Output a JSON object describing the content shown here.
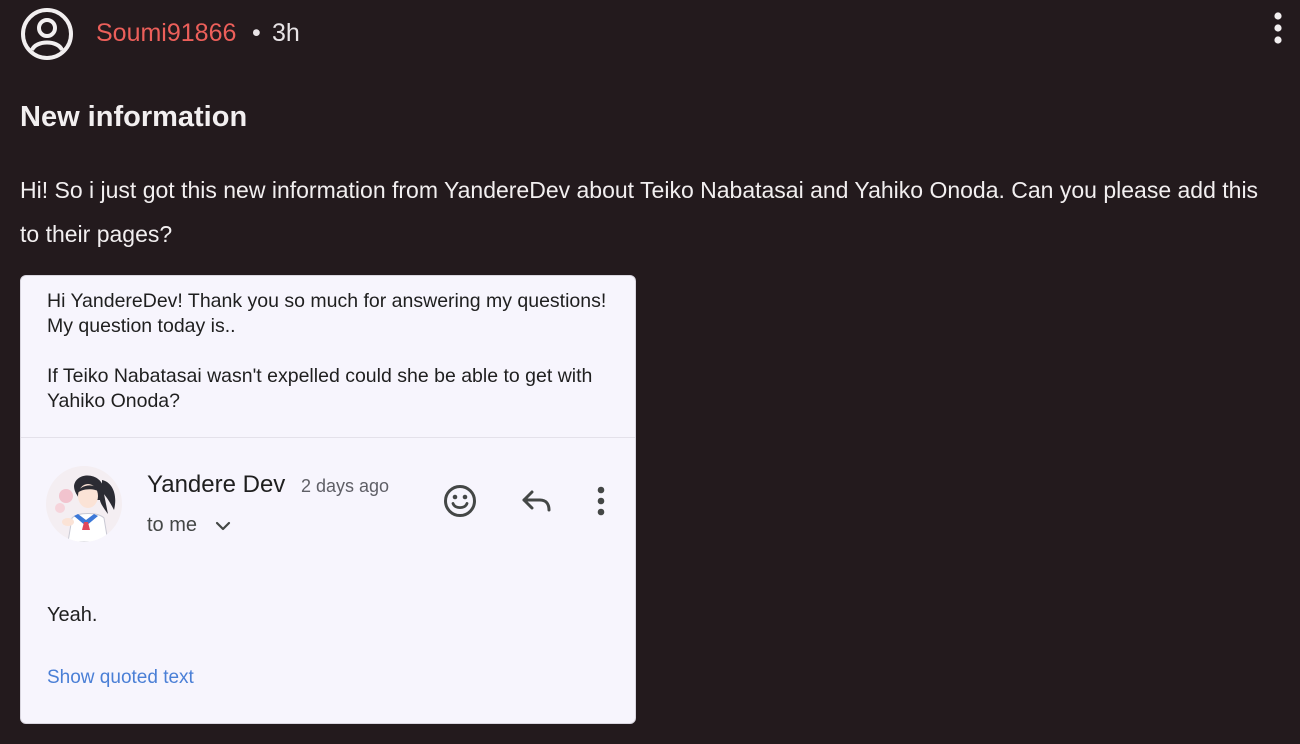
{
  "post": {
    "username": "Soumi91866",
    "separator": "•",
    "time": "3h",
    "title": "New information",
    "body": "Hi! So i just got this new information from YandereDev about Teiko Nabatasai and Yahiko Onoda. Can you please add this to their pages?"
  },
  "email": {
    "question_intro": "Hi YandereDev! Thank you so much for answering my questions! My question today is..",
    "question": "If Teiko Nabatasai wasn't expelled could she be able to get with Yahiko Onoda?",
    "sender_name": "Yandere Dev",
    "sent_time": "2 days ago",
    "recipient": "to me",
    "reply_body": "Yeah.",
    "show_quoted_label": "Show quoted text"
  },
  "icons": {
    "user_avatar": "user-circle-icon",
    "post_menu": "more-vertical-icon",
    "emoji": "emoji-smile-icon",
    "reply": "reply-arrow-icon",
    "email_menu": "more-vertical-icon",
    "expand": "chevron-down-icon"
  },
  "colors": {
    "background": "#231a1d",
    "username": "#ec5f5a",
    "card_background": "#f7f5fd",
    "link": "#4a7fd6"
  }
}
